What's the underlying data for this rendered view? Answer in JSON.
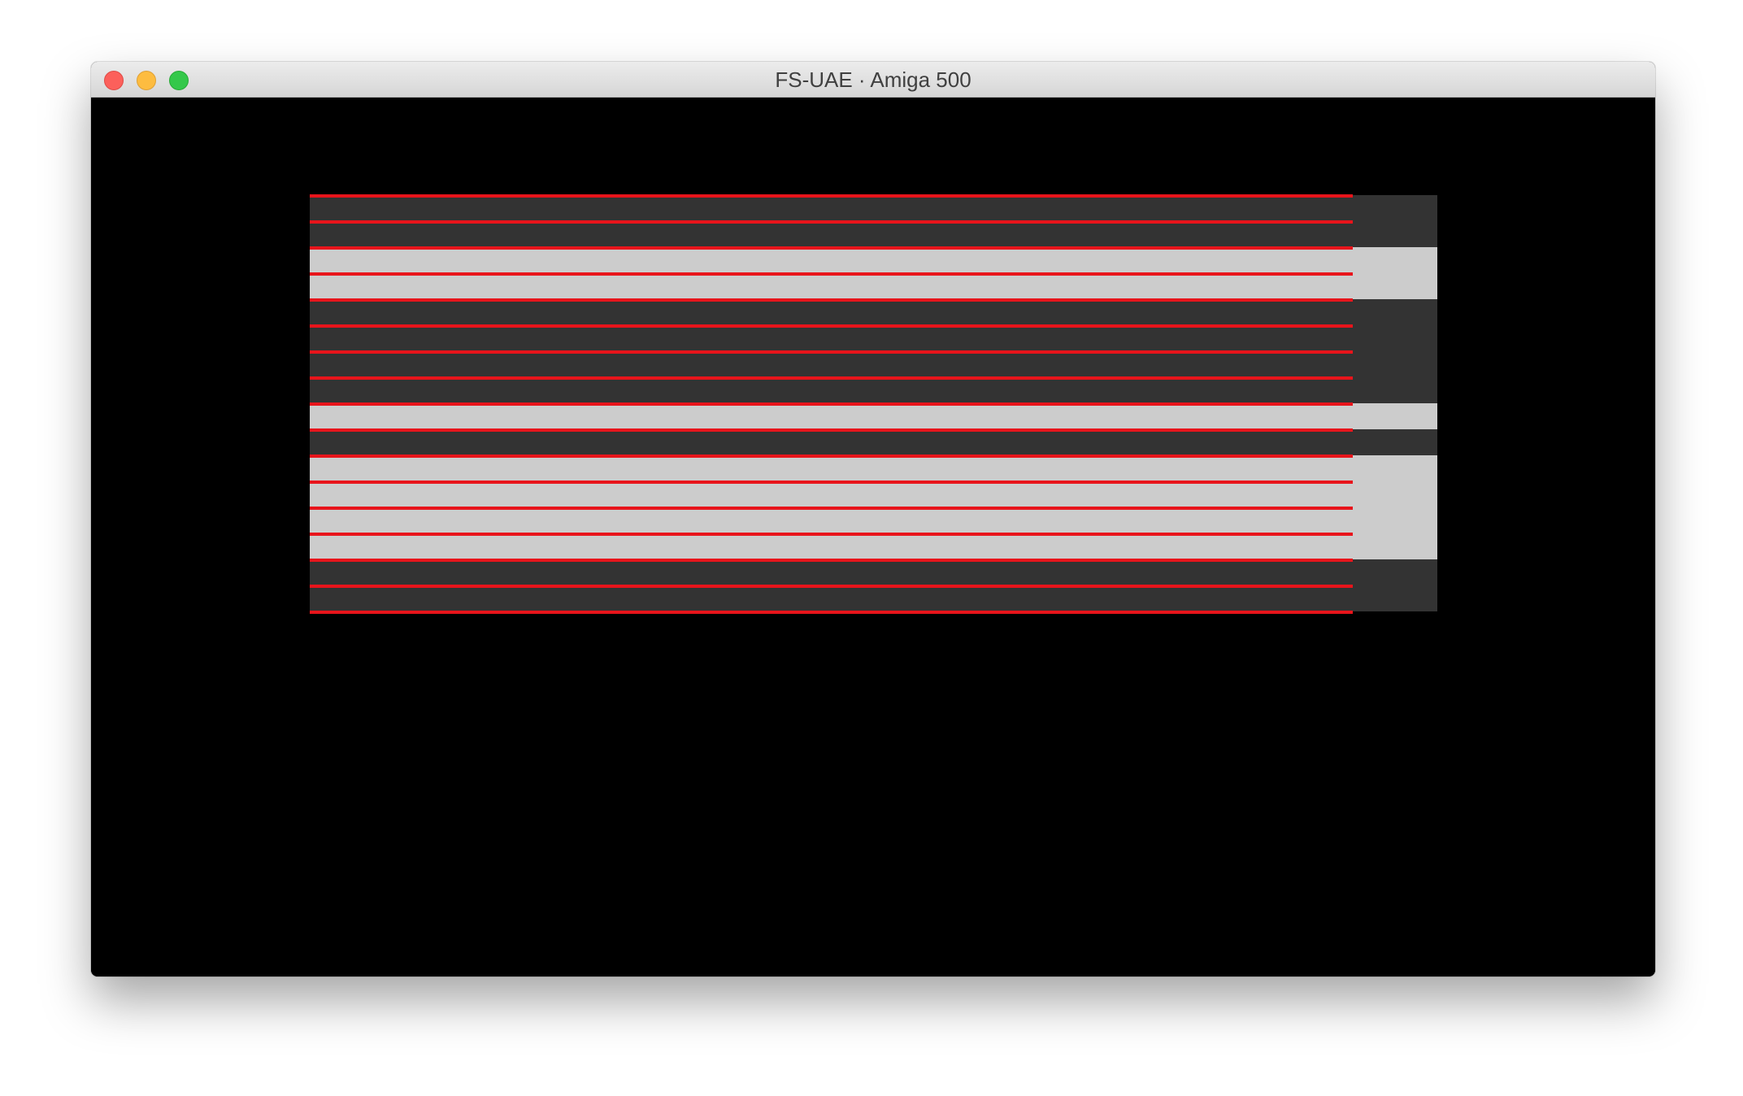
{
  "window": {
    "title": "FS-UAE · Amiga 500"
  },
  "colors": {
    "dark_band": "#333333",
    "light_band": "#cccccc",
    "raster_line": "#e8141b",
    "screen_background": "#000000"
  },
  "screen": {
    "bands": [
      "dark",
      "light",
      "dark",
      "light",
      "dark",
      "light",
      "dark"
    ],
    "raster_line_count": 17
  }
}
